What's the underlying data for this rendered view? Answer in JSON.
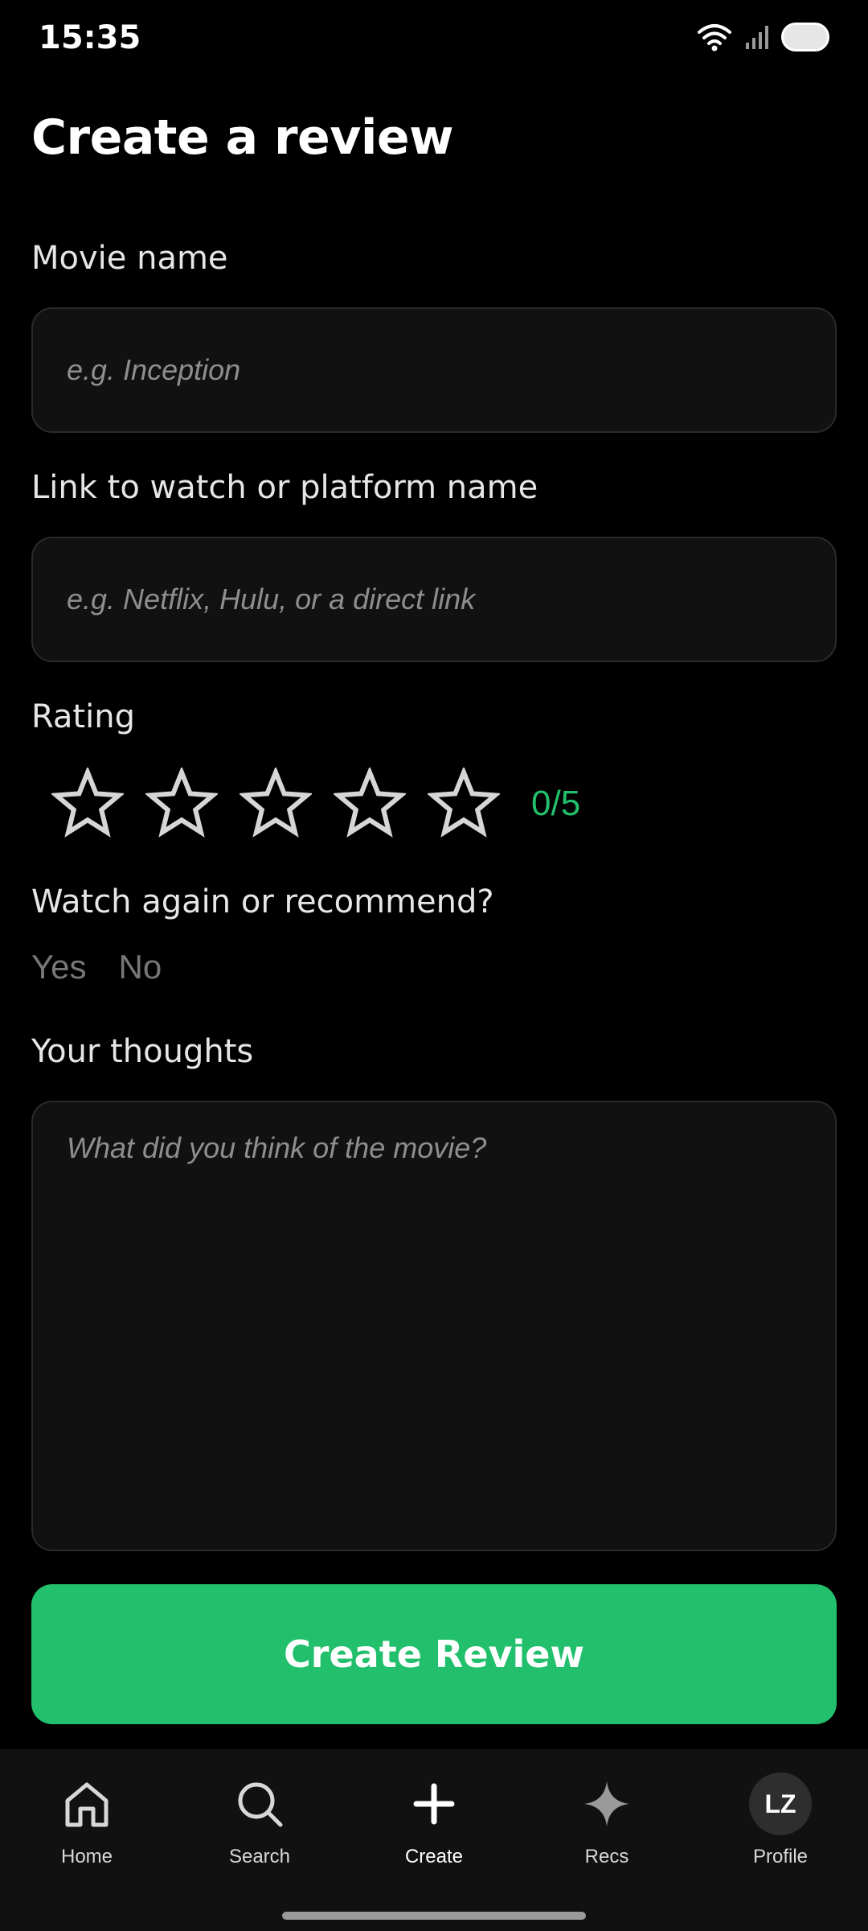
{
  "status_bar": {
    "time": "15:35"
  },
  "page": {
    "title": "Create a review"
  },
  "form": {
    "movie_name": {
      "label": "Movie name",
      "placeholder": "e.g. Inception",
      "value": ""
    },
    "link": {
      "label": "Link to watch or platform name",
      "placeholder": "e.g. Netflix, Hulu, or a direct link",
      "value": ""
    },
    "rating": {
      "label": "Rating",
      "value": 0,
      "max": 5,
      "display": "0/5"
    },
    "recommend": {
      "label": "Watch again or recommend?",
      "yes_label": "Yes",
      "no_label": "No"
    },
    "thoughts": {
      "label": "Your thoughts",
      "placeholder": "What did you think of the movie?",
      "value": ""
    },
    "submit_label": "Create Review"
  },
  "bottom_nav": {
    "items": [
      {
        "label": "Home",
        "icon": "home-icon"
      },
      {
        "label": "Search",
        "icon": "search-icon"
      },
      {
        "label": "Create",
        "icon": "plus-icon",
        "active": true
      },
      {
        "label": "Recs",
        "icon": "sparkle-icon"
      },
      {
        "label": "Profile",
        "icon": "avatar",
        "avatar_initials": "LZ"
      }
    ]
  },
  "colors": {
    "accent": "#22c06c",
    "background": "#000000",
    "field_background": "#111111",
    "nav_background": "#111111"
  }
}
